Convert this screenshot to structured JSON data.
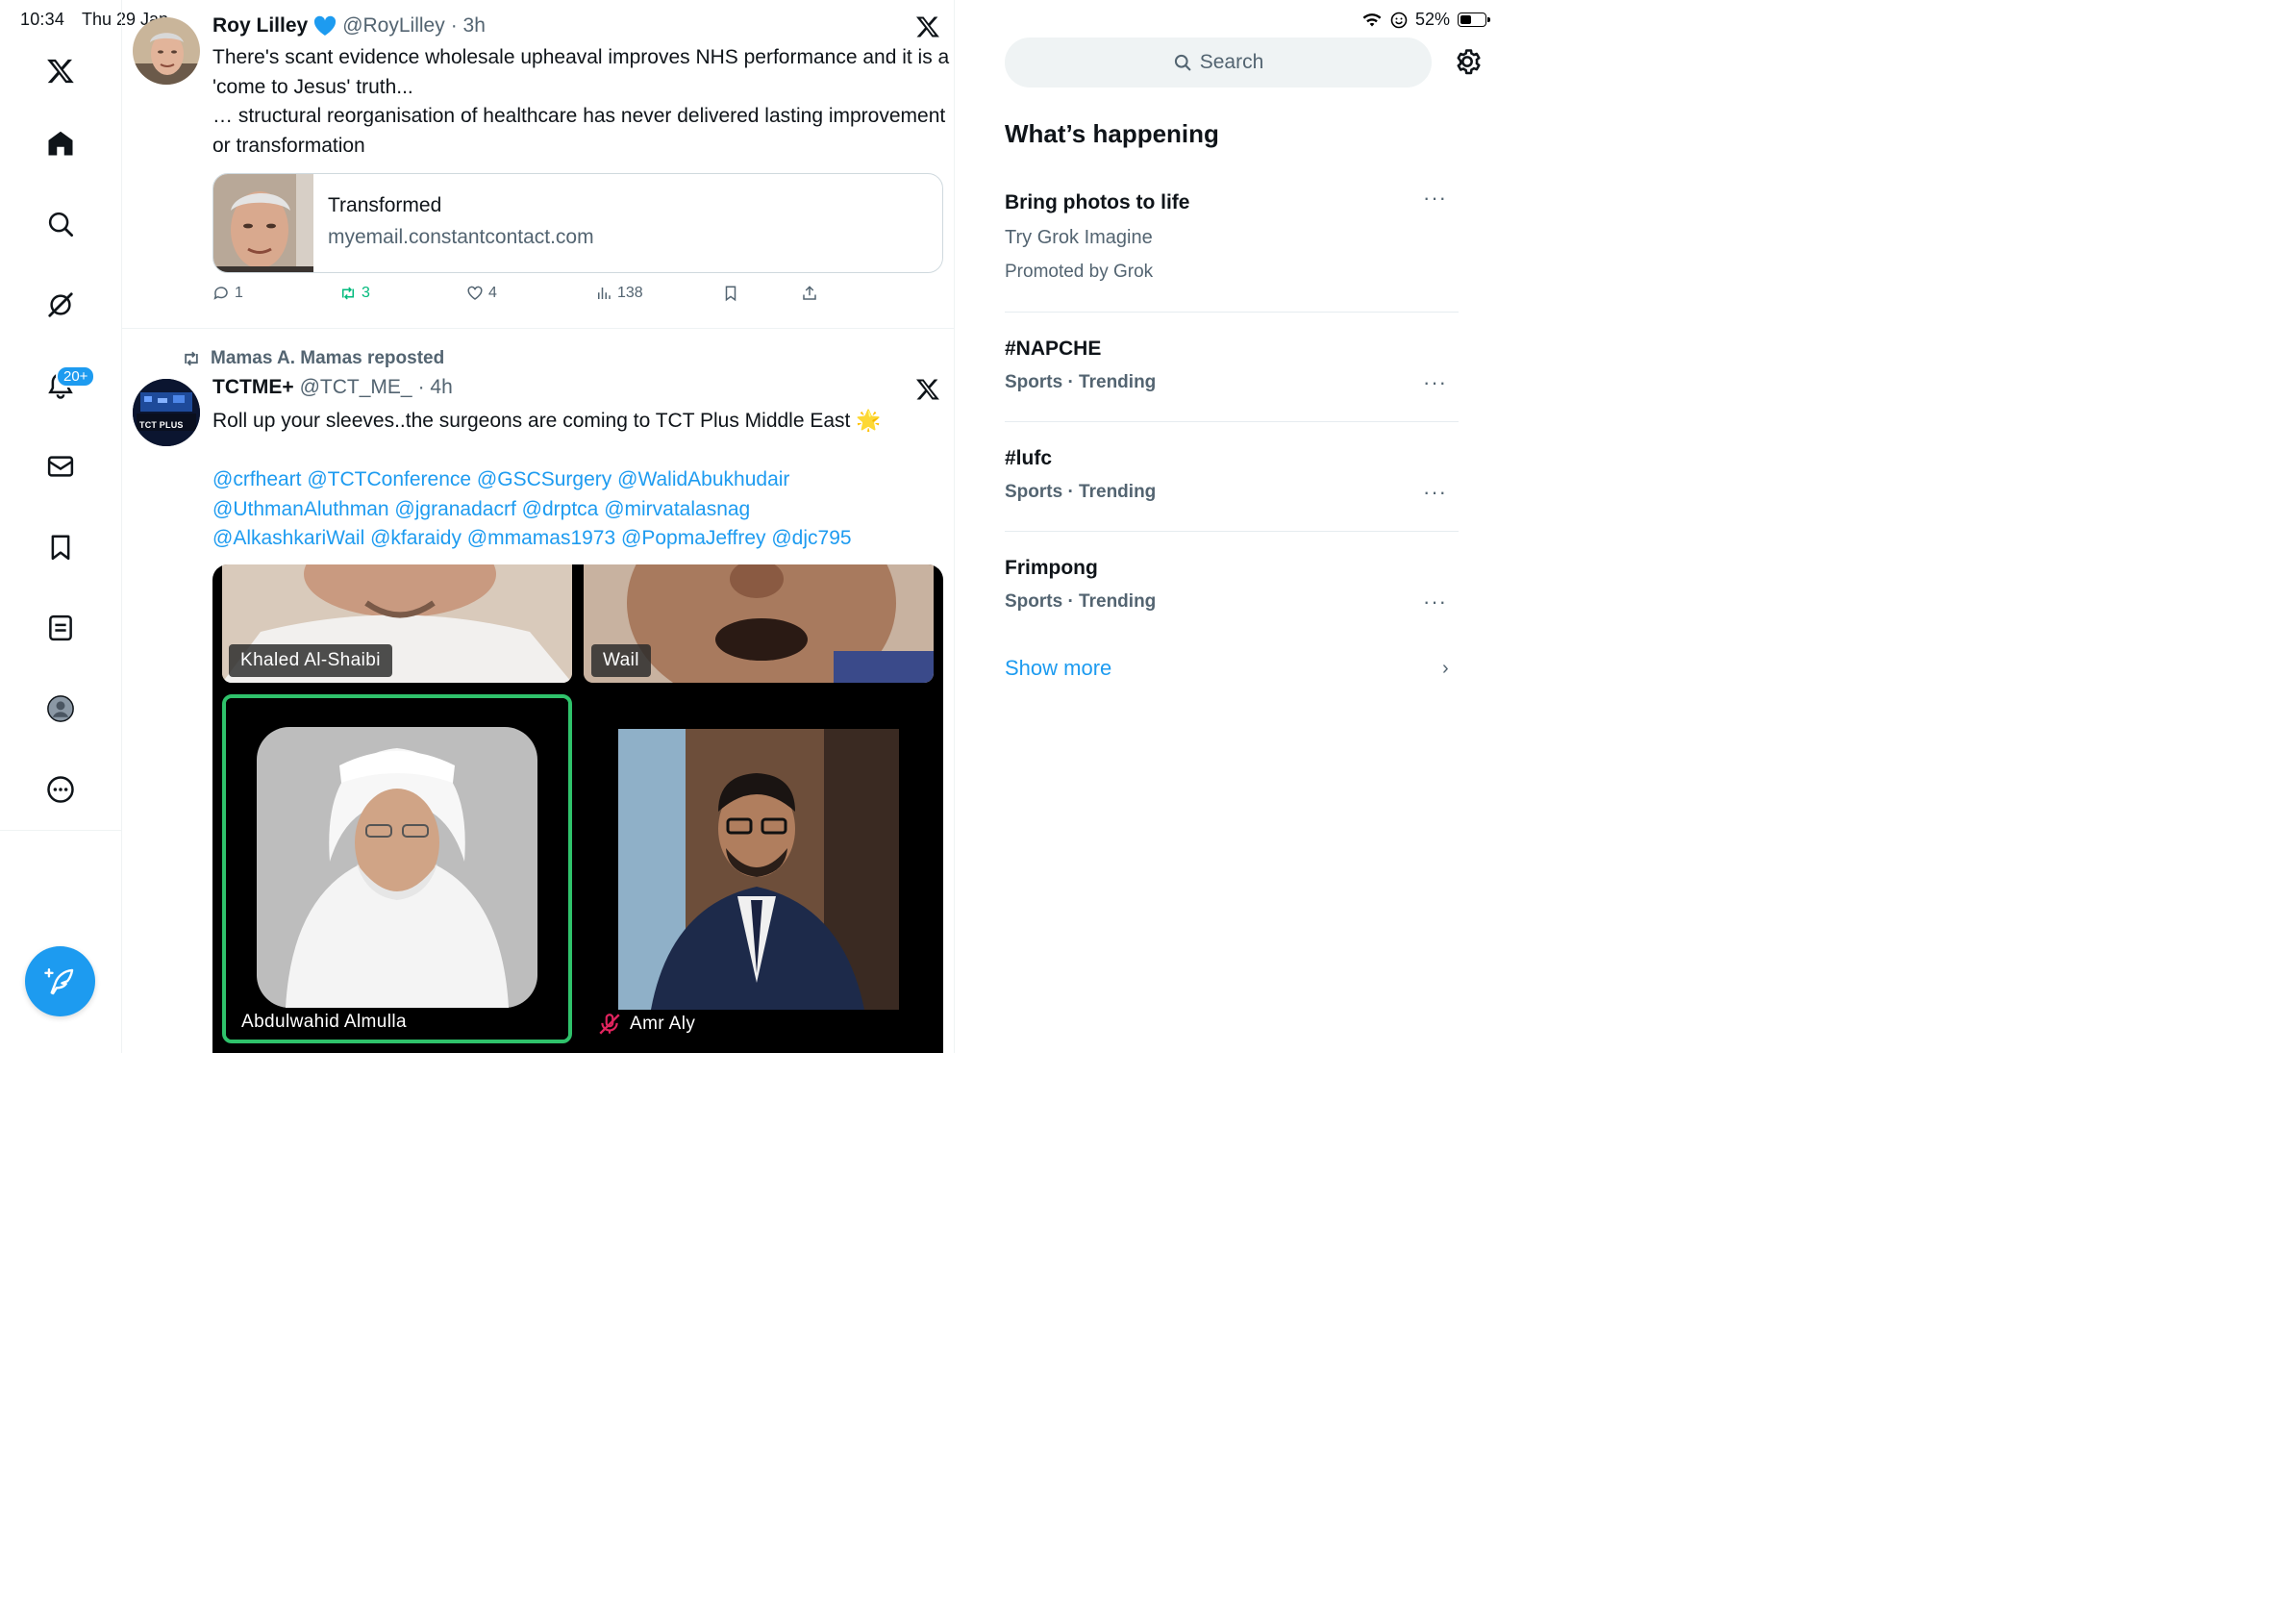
{
  "status_bar": {
    "time": "10:34",
    "date": "Thu 29 Jan",
    "battery": "52%",
    "battery_level": 0.52
  },
  "nav": {
    "items": [
      "logo",
      "home",
      "search",
      "grok",
      "notifications",
      "messages",
      "bookmarks",
      "lists",
      "profile",
      "more"
    ],
    "notification_badge": "20+"
  },
  "tweets": [
    {
      "author": "Roy Lilley",
      "handle": "@RoyLilley",
      "time": "· 3h",
      "text": "There's scant evidence wholesale upheaval improves NHS performance and it is a 'come to Jesus' truth...\n… structural reorganisation of healthcare has never delivered lasting improvement or transformation",
      "link_card": {
        "title": "Transformed",
        "domain": "myemail.constantcontact.com"
      },
      "stats": {
        "replies": "1",
        "reposts": "3",
        "likes": "4",
        "views": "138"
      }
    },
    {
      "reposted_by": "Mamas A. Mamas reposted",
      "author": "TCTME+",
      "handle": "@TCT_ME_",
      "time": "· 4h",
      "text": "Roll up your sleeves..the surgeons are coming to TCT Plus Middle East 🌟",
      "mentions": [
        "@crfheart",
        "@TCTConference",
        "@GSCSurgery",
        "@WalidAbukhudair",
        "@UthmanAluthman",
        "@jgranadacrf",
        "@drptca",
        "@mirvatalasnag",
        "@AlkashkariWail",
        "@kfaraidy",
        "@mmamas1973",
        "@PopmaJeffrey",
        "@djc795"
      ],
      "media_labels": [
        "Khaled Al-Shaibi",
        "Wail",
        "Abdulwahid Almulla",
        "Amr Aly"
      ],
      "avatar_text": "TCT PLUS"
    }
  ],
  "right": {
    "search_placeholder": "Search",
    "section_title": "What’s happening",
    "promo": {
      "title": "Bring photos to life",
      "subtitle": "Try Grok Imagine",
      "meta": "Promoted by Grok"
    },
    "trends": [
      {
        "name": "#NAPCHE",
        "meta": "Sports · Trending"
      },
      {
        "name": "#lufc",
        "meta": "Sports · Trending"
      },
      {
        "name": "Frimpong",
        "meta": "Sports · Trending"
      }
    ],
    "show_more": "Show more"
  },
  "colors": {
    "accent": "#1d9bf0",
    "repost_green": "#00ba7c",
    "secondary_text": "#536471"
  }
}
